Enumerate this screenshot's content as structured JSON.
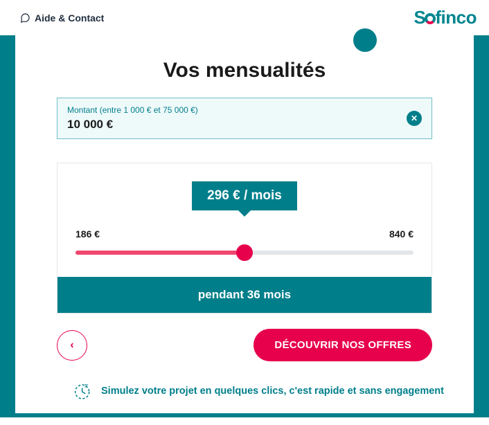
{
  "header": {
    "help_label": "Aide & Contact",
    "logo_text_before": "S",
    "logo_text_after": "finco"
  },
  "title": "Vos mensualités",
  "amount": {
    "hint": "Montant (entre 1 000 € et 75 000 €)",
    "value": "10 000  €",
    "clear_symbol": "✕"
  },
  "slider": {
    "bubble": "296 € / mois",
    "min_label": "186 €",
    "max_label": "840 €"
  },
  "duration_label": "pendant 36 mois",
  "actions": {
    "back_symbol": "‹",
    "cta_label": "DÉCOUVRIR NOS OFFRES"
  },
  "footer": {
    "text": "Simulez votre projet en quelques clics, c'est rapide et sans engagement"
  }
}
